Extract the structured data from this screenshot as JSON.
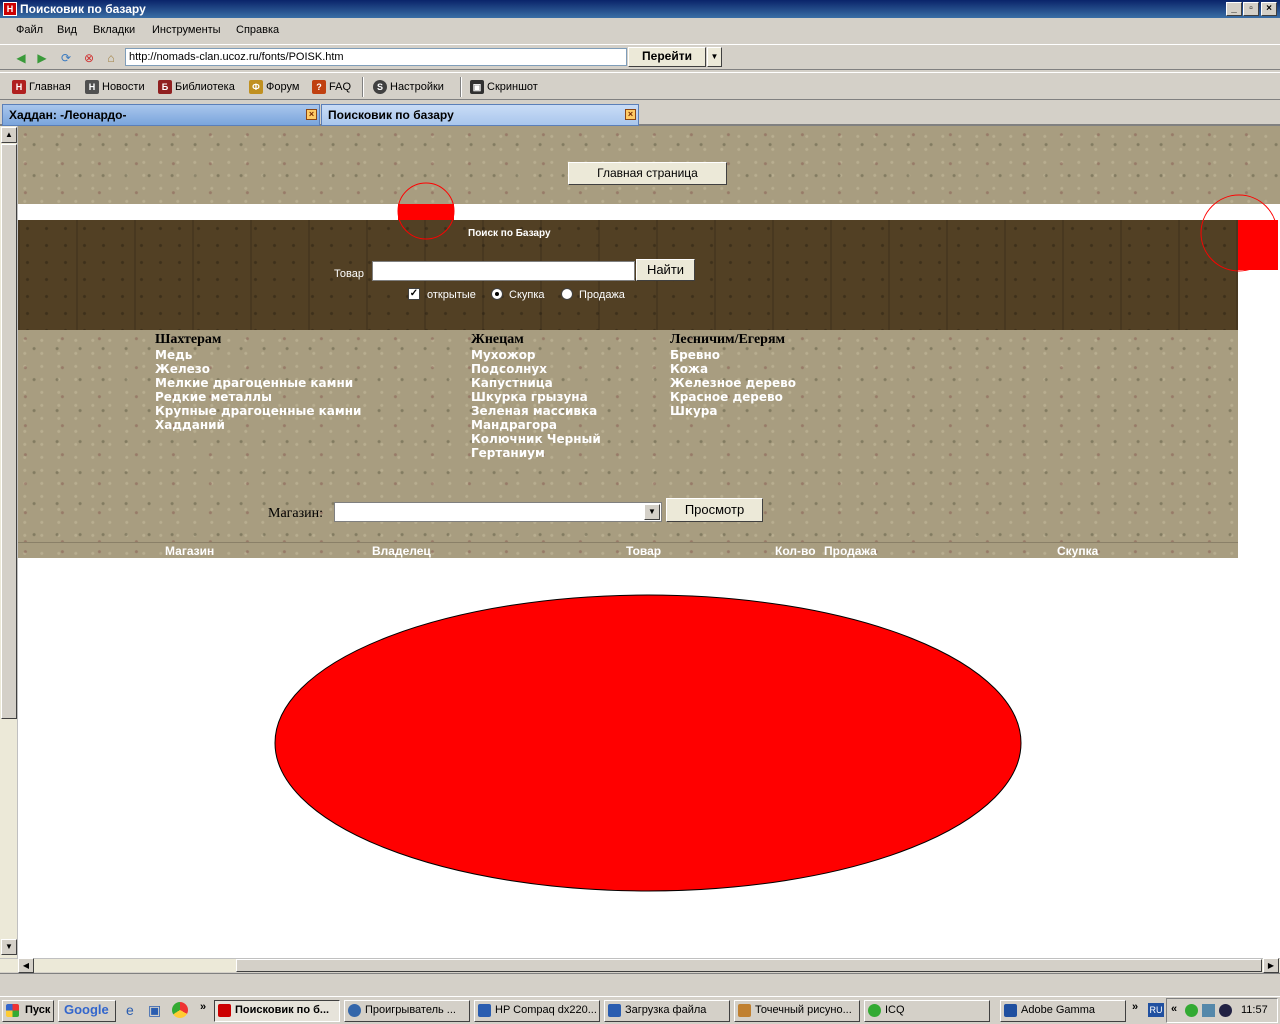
{
  "window": {
    "title": "Поисковик по базару"
  },
  "menu": [
    "Файл",
    "Вид",
    "Вкладки",
    "Инструменты",
    "Справка"
  ],
  "nav": {
    "url": "http://nomads-clan.ucoz.ru/fonts/POISK.htm",
    "go_label": "Перейти"
  },
  "bookmarks": [
    "Главная",
    "Новости",
    "Библиотека",
    "Форум",
    "FAQ",
    "Настройки",
    "Скриншот"
  ],
  "tabs": [
    {
      "label": "Хаддан: -Леонардо-"
    },
    {
      "label": "Поисковик по базару"
    }
  ],
  "page": {
    "main_button": "Главная страница",
    "search": {
      "title": "Поиск по Базару",
      "item_label": "Товар",
      "item_value": "",
      "find_button": "Найти",
      "options": {
        "open": "открытые",
        "buy": "Скупка",
        "sell": "Продажа"
      }
    },
    "categories": [
      {
        "title": "Шахтерам",
        "items": [
          "Медь",
          "Железо",
          "Мелкие драгоценные камни",
          "Редкие металлы",
          "Крупные драгоценные камни",
          "Хадданий"
        ]
      },
      {
        "title": "Жнецам",
        "items": [
          "Мухожор",
          "Подсолнух",
          "Капустница",
          "Шкурка грызуна",
          "Зеленая массивка",
          "Мандрагора",
          "Колючник Черный",
          "Гертаниум"
        ]
      },
      {
        "title": "Лесничим/Егерям",
        "items": [
          "Бревно",
          "Кожа",
          "Железное дерево",
          "Красное дерево",
          "Шкура"
        ]
      }
    ],
    "shop": {
      "label": "Магазин:",
      "value": "",
      "view_button": "Просмотр"
    },
    "table_headers": [
      "Магазин",
      "Владелец",
      "Товар",
      "Кол-во",
      "Продажа",
      "Скупка"
    ]
  },
  "taskbar": {
    "start": "Пуск",
    "google": "Google",
    "tasks": [
      "Поисковик по б...",
      "Проигрыватель ...",
      "HP Compaq dx220...",
      "Загрузка файла",
      "Точечный рисуно...",
      "ICQ",
      "Adobe Gamma"
    ],
    "lang": "RU",
    "clock": "11:57"
  },
  "colors": {
    "annotation_red": "#ff0000",
    "titlebar": "#0a246a",
    "texture": "#a89d80",
    "dark_band": "#524024"
  }
}
